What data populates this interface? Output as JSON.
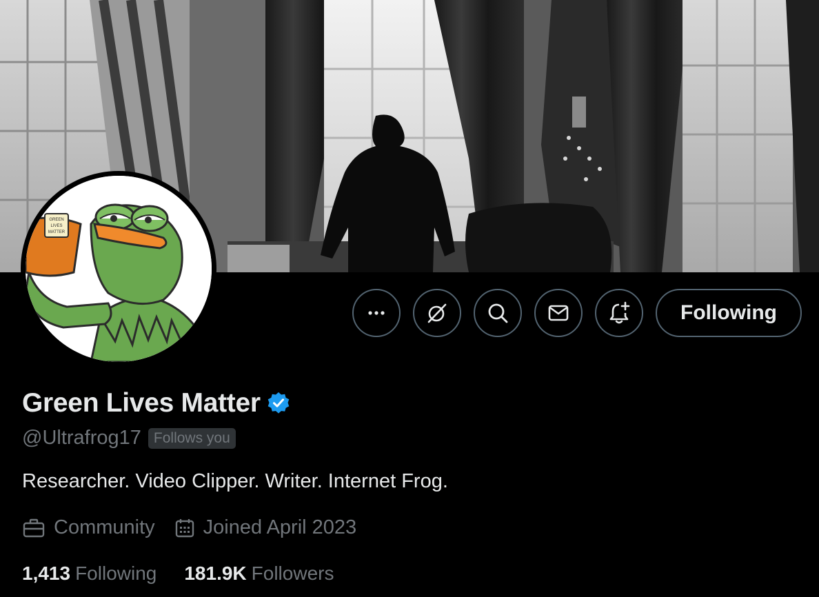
{
  "profile": {
    "display_name": "Green Lives Matter",
    "verified": true,
    "handle": "@Ultrafrog17",
    "follows_you_badge": "Follows you",
    "bio": "Researcher. Video Clipper. Writer. Internet Frog.",
    "category": "Community",
    "joined": "Joined April 2023",
    "avatar_mug_text": "GREEN LIVES MATTER"
  },
  "actions": {
    "more_icon": "more-horizontal-icon",
    "grok_icon": "grok-icon",
    "search_icon": "search-icon",
    "message_icon": "envelope-icon",
    "notify_icon": "bell-plus-icon",
    "following_label": "Following"
  },
  "stats": {
    "following_count": "1,413",
    "following_label": "Following",
    "followers_count": "181.9K",
    "followers_label": "Followers"
  },
  "colors": {
    "background": "#000000",
    "primary_text": "#e7e9ea",
    "secondary_text": "#71767b",
    "border": "#536471",
    "verified_blue": "#1d9bf0",
    "badge_bg": "#2f3336"
  }
}
